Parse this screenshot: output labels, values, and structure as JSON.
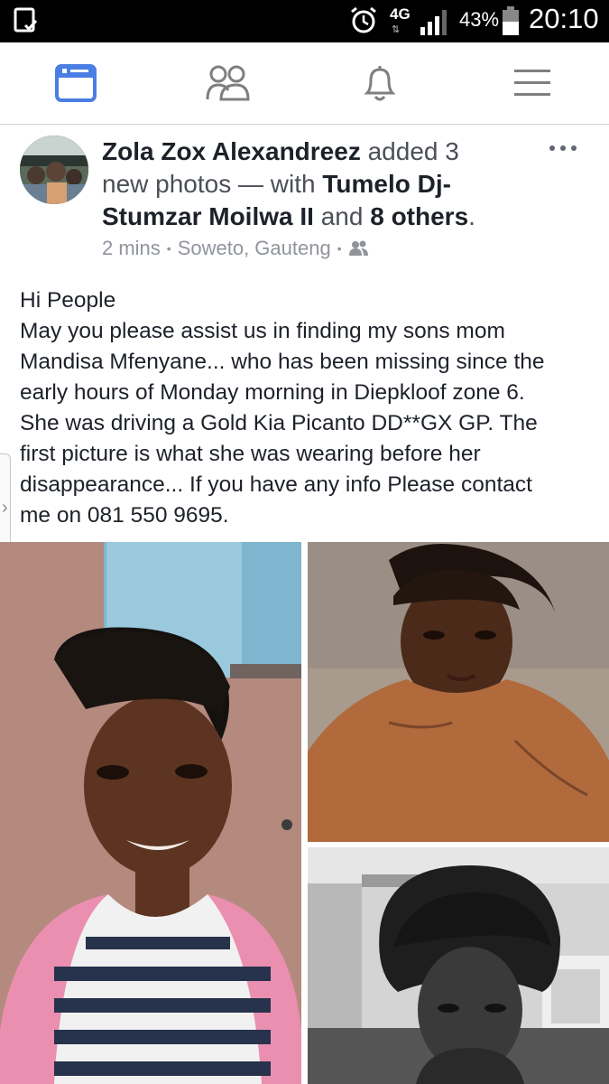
{
  "status_bar": {
    "network": "4G",
    "battery_percent": "43%",
    "time": "20:10",
    "icons": [
      "screen-icon",
      "alarm-icon",
      "network-arrows-icon",
      "signal-icon",
      "battery-icon"
    ]
  },
  "nav": {
    "tabs": [
      {
        "name": "news-feed",
        "icon": "news-feed-icon",
        "active": true
      },
      {
        "name": "friends",
        "icon": "friends-icon",
        "active": false
      },
      {
        "name": "notifications",
        "icon": "bell-icon",
        "active": false
      },
      {
        "name": "menu",
        "icon": "hamburger-menu-icon",
        "active": false
      }
    ],
    "active_color": "#4a7ee3",
    "inactive_color": "#7f7f7f"
  },
  "post": {
    "author": "Zola Zox Alexandreez",
    "action": "added 3 new photos — with",
    "tagged_name": "Tumelo Dj-Stumzar Moilwa II",
    "conjunction": "and",
    "others": "8 others",
    "period": ".",
    "time": "2 mins",
    "location": "Soweto, Gauteng",
    "privacy_icon": "friends-privacy-icon",
    "more_icon": "more-options-icon",
    "text_lines": [
      "Hi People",
      "May you please assist us in finding my sons mom",
      "Mandisa Mfenyane... who has been missing since the",
      "early hours of Monday morning in Diepkloof zone 6.",
      "She was driving a Gold Kia Picanto DD**GX GP. The",
      "first picture is what she was wearing before her",
      "disappearance... If you have any info Please contact",
      "me on 081 550 9695."
    ],
    "photo_count": 3
  },
  "colors": {
    "text_primary": "#1d2129",
    "text_secondary": "#4b4f56",
    "meta": "#90949c",
    "accent": "#4a7ee3"
  }
}
